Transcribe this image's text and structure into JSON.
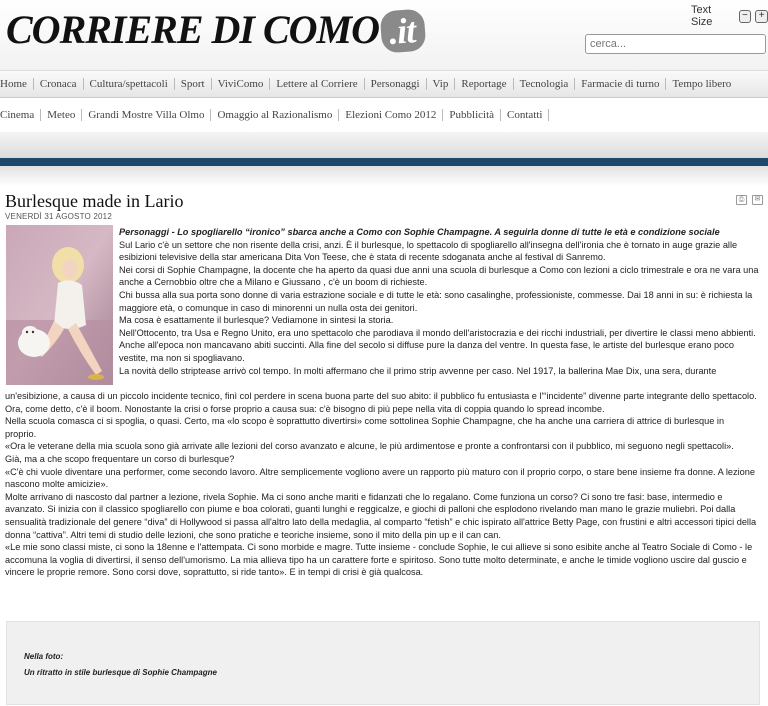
{
  "header": {
    "logo_main": "CORRIERE DI COMO",
    "logo_suffix": ".it",
    "text_size_label": "Text Size",
    "text_size_decrease": "−",
    "text_size_increase": "+",
    "search_placeholder": "cerca..."
  },
  "nav_primary": [
    "Home",
    "Cronaca",
    "Cultura/spettacoli",
    "Sport",
    "ViviComo",
    "Lettere al Corriere",
    "Personaggi",
    "Vip",
    "Reportage",
    "Tecnologia",
    "Farmacie di turno",
    "Tempo libero"
  ],
  "nav_secondary": [
    "Cinema",
    "Meteo",
    "Grandi Mostre Villa Olmo",
    "Omaggio al Razionalismo",
    "Elezioni Como 2012",
    "Pubblicità",
    "Contatti"
  ],
  "article": {
    "title": "Burlesque made in Lario",
    "date": "VENERDÌ 31 AGOSTO 2012",
    "lead": "Personaggi - Lo spogliarello “ironico” sbarca anche a Como con Sophie Champagne. A seguirla donne di tutte le età e condizione sociale",
    "paragraphs_beside": [
      "Sul Lario c'è un settore che non risente della crisi, anzi. È il burlesque, lo spettacolo di spogliarello all'insegna dell'ironia che è tornato in auge grazie alle esibizioni televisive della star americana Dita Von Teese, che è stata di recente sdoganata anche al festival di Sanremo.",
      "Nei corsi di Sophie Champagne, la docente che ha aperto da quasi due anni una scuola di burlesque a Como con lezioni a ciclo trimestrale e ora ne vara una anche a Cernobbio oltre che a Milano e Giussano , c'è un boom di richieste.",
      "Chi bussa alla sua porta sono donne di varia estrazione sociale e di tutte le età: sono casalinghe, professioniste, commesse. Dai 18 anni in su: è richiesta la maggiore età, o comunque in caso di minorenni un nulla osta dei genitori.",
      "Ma cosa è esattamente il burlesque? Vediamone in sintesi la storia.",
      "Nell'Ottocento, tra Usa e Regno Unito, era uno spettacolo che parodiava il mondo dell'aristocrazia e dei ricchi industriali, per divertire le classi meno abbienti.",
      "Anche all'epoca non mancavano abiti succinti. Alla fine del secolo si diffuse pure la danza del ventre. In questa fase, le artiste del burlesque erano poco vestite, ma non si spogliavano.",
      "La novità dello striptease arrivò col tempo. In molti affermano che il primo strip avvenne per caso. Nel 1917, la ballerina Mae Dix, una sera, durante"
    ],
    "paragraphs_full": [
      "un'esibizione, a causa di un piccolo incidente tecnico, finì col perdere in scena buona parte del suo abito: il pubblico fu entusiasta e l'“incidente” divenne parte integrante dello spettacolo.",
      "Ora, come detto, c'è il boom. Nonostante la crisi o forse proprio a causa sua: c'è bisogno di più pepe nella vita di coppia quando lo spread incombe.",
      "Nella scuola comasca ci si spoglia, o quasi. Certo, ma «lo scopo è soprattutto divertirsi» come sottolinea Sophie Champagne, che ha anche una carriera di attrice di burlesque in proprio.",
      "«Ora le veterane della mia scuola sono già arrivate alle lezioni del corso avanzato e alcune, le più ardimentose e pronte a confrontarsi con il pubblico, mi seguono negli spettacoli».",
      "Già, ma a che scopo frequentare un corso di burlesque?",
      "«C'è chi vuole diventare una performer, come secondo lavoro. Altre semplicemente vogliono avere un rapporto più maturo con il proprio corpo, o stare bene insieme fra donne. A lezione nascono molte amicizie».",
      "Molte arrivano di nascosto dal partner a lezione, rivela Sophie. Ma ci sono anche mariti e fidanzati che lo regalano. Come funziona un corso? Ci sono tre fasi: base, intermedio e avanzato. Si inizia con il classico spogliarello con piume e boa colorati, guanti lunghi e reggicalze, e giochi di palloni che esplodono rivelando man mano le grazie muliebri. Poi dalla sensualità tradizionale del genere “diva” di Hollywood si passa all'altro lato della medaglia, al comparto “fetish” e chic ispirato all'attrice Betty Page, con frustini e altri accessori tipici della donna “cattiva”. Altri temi di studio delle lezioni, che sono pratiche e teoriche insieme, sono il mito della pin up e il can can.",
      "«Le mie sono classi miste, ci sono la 18enne e l'attempata. Ci sono morbide e magre. Tutte insieme - conclude Sophie, le cui allieve si sono esibite anche al Teatro Sociale di Como - le accomuna la voglia di divertirsi, il senso dell'umorismo. La mia allieva tipo ha un carattere forte e spiritoso. Sono tutte molto determinate, e anche le timide vogliono uscire dal guscio e vincere le proprie remore. Sono corsi dove, soprattutto, si ride tanto». E in tempi di crisi è già qualcosa."
    ],
    "caption_label": "Nella foto:",
    "caption_text": "Un ritratto in stile burlesque di Sophie Champagne"
  },
  "colors": {
    "accent_bar": "#1d4a6a",
    "nav_text": "#444444",
    "caption_bg": "#f0f0f0"
  }
}
